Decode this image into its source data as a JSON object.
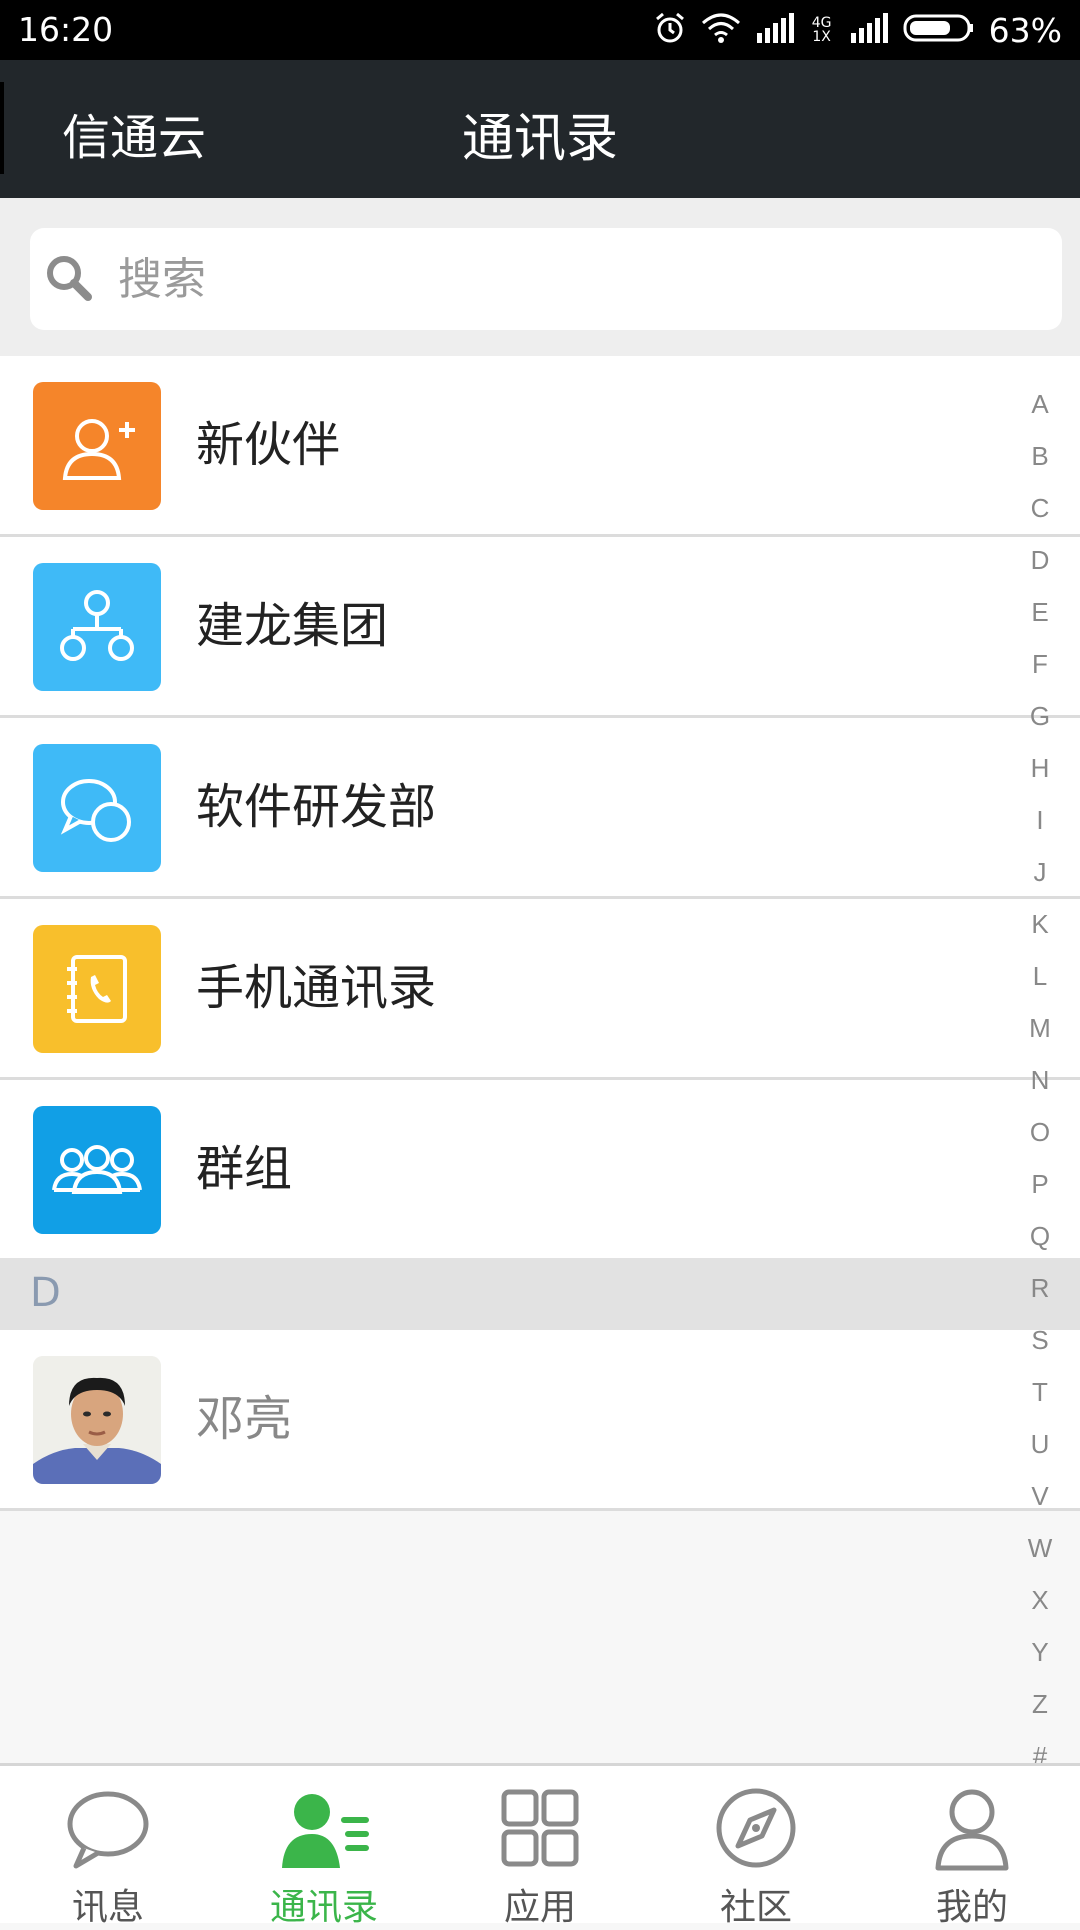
{
  "status_bar": {
    "time": "16:20",
    "network": "4G 1X",
    "battery": "63%",
    "icons": [
      "alarm-icon",
      "wifi-icon",
      "signal-icon",
      "battery-icon"
    ]
  },
  "header": {
    "app_name": "信通云",
    "title": "通讯录"
  },
  "search": {
    "placeholder": "搜索",
    "value": ""
  },
  "entries": [
    {
      "label": "新伙伴",
      "icon": "add-user-icon",
      "color": "#f5852a"
    },
    {
      "label": "建龙集团",
      "icon": "org-chart-icon",
      "color": "#3fbaf7"
    },
    {
      "label": "软件研发部",
      "icon": "chat-bubbles-icon",
      "color": "#3fbaf7"
    },
    {
      "label": "手机通讯录",
      "icon": "phone-book-icon",
      "color": "#f8bf2c"
    },
    {
      "label": "群组",
      "icon": "group-icon",
      "color": "#119fe6"
    }
  ],
  "sections": [
    {
      "letter": "D",
      "contacts": [
        {
          "name": "邓亮",
          "icon": "avatar-photo"
        }
      ]
    }
  ],
  "alphabet_index": [
    "A",
    "B",
    "C",
    "D",
    "E",
    "F",
    "G",
    "H",
    "I",
    "J",
    "K",
    "L",
    "M",
    "N",
    "O",
    "P",
    "Q",
    "R",
    "S",
    "T",
    "U",
    "V",
    "W",
    "X",
    "Y",
    "Z",
    "#"
  ],
  "tabs": [
    {
      "label": "讯息",
      "icon": "chat-icon",
      "active": false
    },
    {
      "label": "通讯录",
      "icon": "contacts-icon",
      "active": true
    },
    {
      "label": "应用",
      "icon": "apps-grid-icon",
      "active": false
    },
    {
      "label": "社区",
      "icon": "compass-icon",
      "active": false
    },
    {
      "label": "我的",
      "icon": "person-icon",
      "active": false
    }
  ],
  "colors": {
    "header_bg": "#22272b",
    "active_tab": "#3bb54a",
    "inactive_tab": "#8a8a8a"
  }
}
